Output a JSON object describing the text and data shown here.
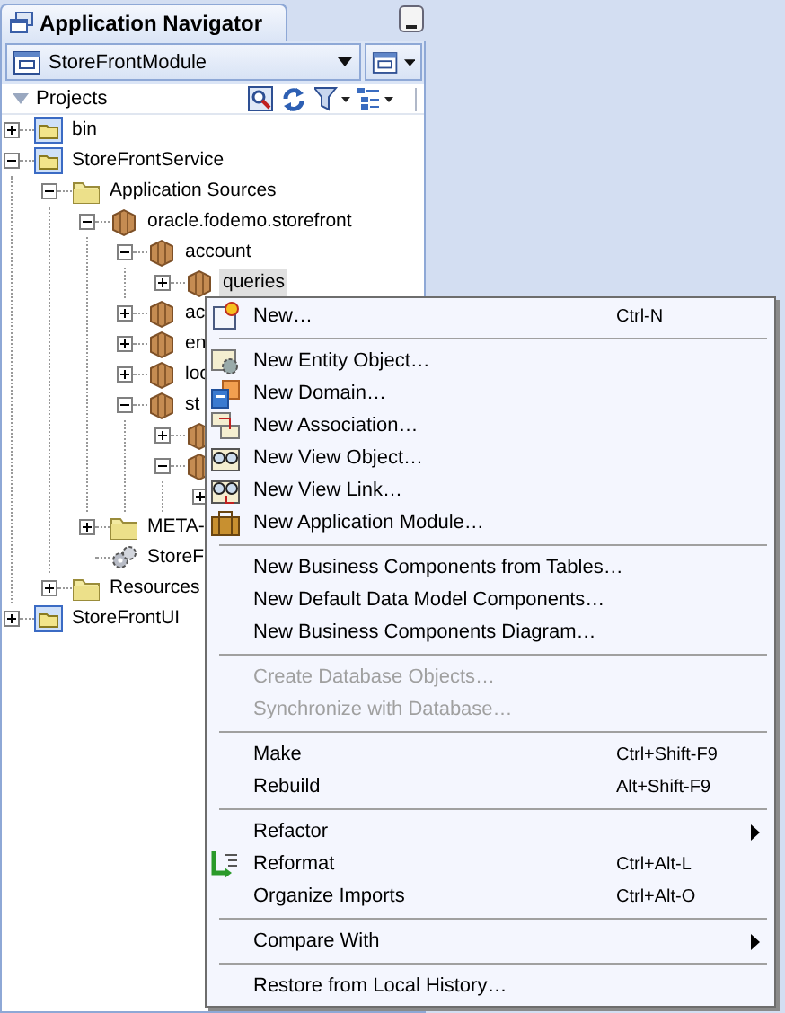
{
  "panel": {
    "title": "Application Navigator",
    "module": "StoreFrontModule",
    "section": "Projects"
  },
  "tree": [
    {
      "label": "bin",
      "kind": "project",
      "expanded": false,
      "selected": false
    },
    {
      "label": "StoreFrontService",
      "kind": "project",
      "expanded": true,
      "selected": false,
      "children": [
        {
          "label": "Application Sources",
          "kind": "folder",
          "expanded": true,
          "selected": false,
          "children": [
            {
              "label": "oracle.fodemo.storefront",
              "kind": "package",
              "expanded": true,
              "selected": false,
              "children": [
                {
                  "label": "account",
                  "kind": "package",
                  "expanded": true,
                  "selected": false,
                  "children": [
                    {
                      "label": "queries",
                      "kind": "package",
                      "expanded": false,
                      "selected": true
                    }
                  ]
                },
                {
                  "label": "ac",
                  "kind": "package",
                  "expanded": false,
                  "selected": false
                },
                {
                  "label": "en",
                  "kind": "package",
                  "expanded": false,
                  "selected": false
                },
                {
                  "label": "loc",
                  "kind": "package",
                  "expanded": false,
                  "selected": false
                },
                {
                  "label": "st",
                  "kind": "package",
                  "expanded": true,
                  "selected": false,
                  "children": [
                    {
                      "kind": "package",
                      "expanded": false
                    },
                    {
                      "kind": "package",
                      "expanded": true,
                      "children": [
                        {
                          "expanded": false
                        }
                      ]
                    }
                  ]
                }
              ]
            },
            {
              "label": "META-",
              "kind": "folder",
              "expanded": false,
              "selected": false
            },
            {
              "label": "StoreF",
              "kind": "gears",
              "selected": false
            }
          ]
        },
        {
          "label": "Resources",
          "kind": "folder",
          "expanded": false,
          "selected": false
        }
      ]
    },
    {
      "label": "StoreFrontUI",
      "kind": "project",
      "expanded": false,
      "selected": false
    }
  ],
  "menu": [
    {
      "kind": "new",
      "label": "New…",
      "shortcut": "Ctrl-N",
      "disabled": false,
      "submenu": false
    },
    {
      "kind": "separator"
    },
    {
      "kind": "entity",
      "label": "New Entity Object…",
      "disabled": false,
      "submenu": false
    },
    {
      "kind": "domain",
      "label": "New Domain…",
      "disabled": false,
      "submenu": false
    },
    {
      "kind": "association",
      "label": "New Association…",
      "disabled": false,
      "submenu": false
    },
    {
      "kind": "view",
      "label": "New View Object…",
      "disabled": false,
      "submenu": false
    },
    {
      "kind": "viewlink",
      "label": "New View Link…",
      "disabled": false,
      "submenu": false
    },
    {
      "kind": "module",
      "label": "New Application Module…",
      "disabled": false,
      "submenu": false
    },
    {
      "kind": "separator"
    },
    {
      "kind": "plain",
      "label": "New Business Components from Tables…",
      "disabled": false,
      "submenu": false
    },
    {
      "kind": "plain",
      "label": "New Default Data Model Components…",
      "disabled": false,
      "submenu": false
    },
    {
      "kind": "plain",
      "label": "New Business Components Diagram…",
      "disabled": false,
      "submenu": false
    },
    {
      "kind": "separator"
    },
    {
      "kind": "plain",
      "label": "Create Database Objects…",
      "disabled": true,
      "submenu": false
    },
    {
      "kind": "plain",
      "label": "Synchronize with Database…",
      "disabled": true,
      "submenu": false
    },
    {
      "kind": "separator"
    },
    {
      "kind": "plain",
      "label": "Make",
      "shortcut": "Ctrl+Shift-F9",
      "disabled": false,
      "submenu": false
    },
    {
      "kind": "plain",
      "label": "Rebuild",
      "shortcut": "Alt+Shift-F9",
      "disabled": false,
      "submenu": false
    },
    {
      "kind": "separator"
    },
    {
      "kind": "plain",
      "label": "Refactor",
      "disabled": false,
      "submenu": true
    },
    {
      "kind": "reformat",
      "label": "Reformat",
      "shortcut": "Ctrl+Alt-L",
      "disabled": false,
      "submenu": false
    },
    {
      "kind": "plain",
      "label": "Organize Imports",
      "shortcut": "Ctrl+Alt-O",
      "disabled": false,
      "submenu": false
    },
    {
      "kind": "separator"
    },
    {
      "kind": "plain",
      "label": "Compare With",
      "disabled": false,
      "submenu": true
    },
    {
      "kind": "separator"
    },
    {
      "kind": "plain",
      "label": "Restore from Local History…",
      "disabled": false,
      "submenu": false
    }
  ]
}
